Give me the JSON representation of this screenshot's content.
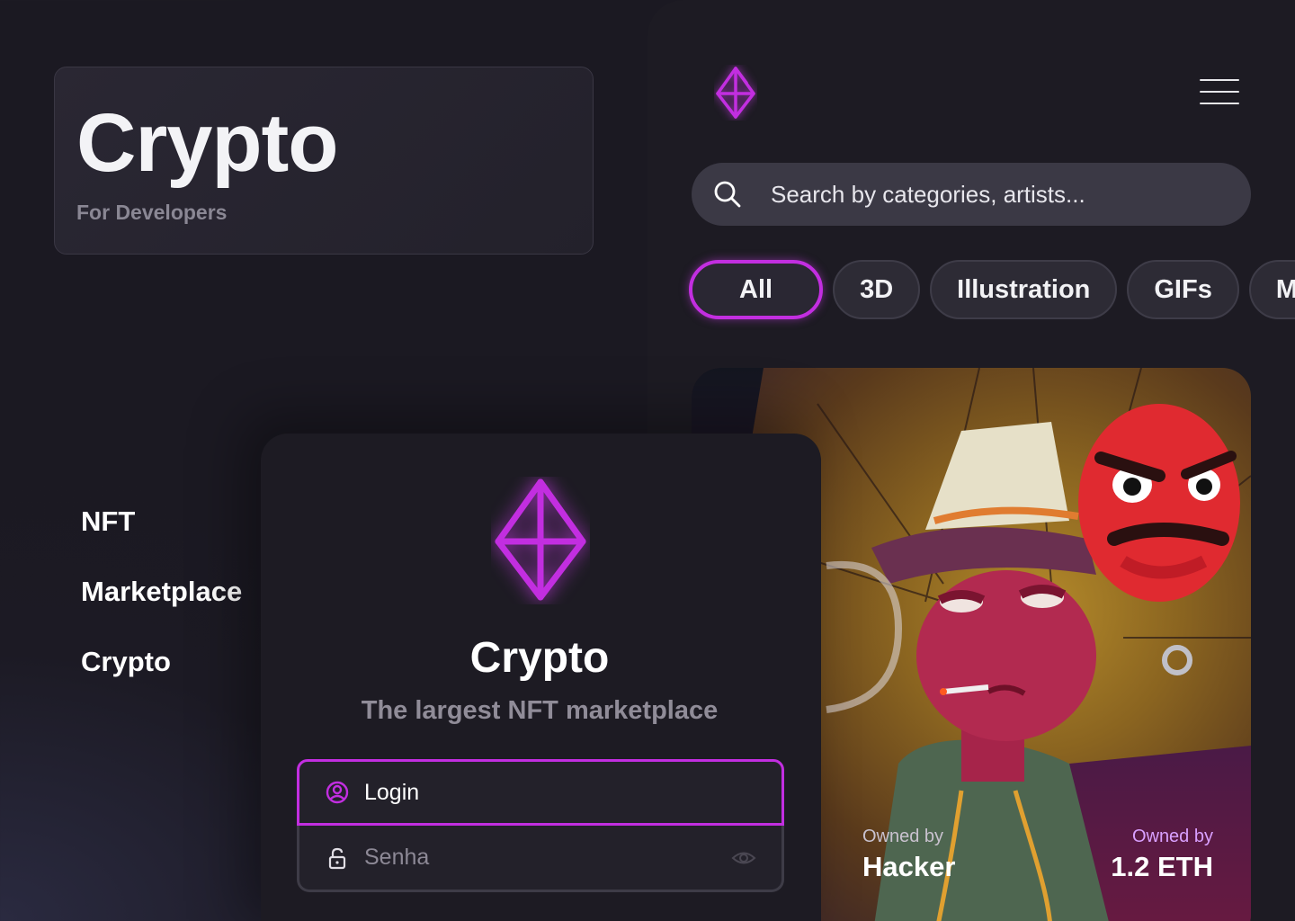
{
  "header": {
    "title": "Crypto",
    "subtitle": "For Developers"
  },
  "app": {
    "logo_icon": "ethereum-diamond-icon",
    "menu_icon": "hamburger-menu-icon",
    "search": {
      "placeholder": "Search by categories, artists...",
      "icon": "search-icon"
    },
    "categories": [
      {
        "label": "All",
        "active": true
      },
      {
        "label": "3D",
        "active": false
      },
      {
        "label": "Illustration",
        "active": false
      },
      {
        "label": "GIFs",
        "active": false
      },
      {
        "label": "Mo",
        "active": false
      }
    ],
    "nft_card": {
      "owner_left_label": "Owned by",
      "owner_left_value": "Hacker",
      "owner_right_label": "Owned by",
      "owner_right_value": "1.2 ETH"
    }
  },
  "side_nav": {
    "items": [
      "NFT",
      "Marketplace",
      "Crypto"
    ]
  },
  "login": {
    "title": "Crypto",
    "tagline": "The largest NFT marketplace",
    "login_placeholder": "Login",
    "password_placeholder": "Senha"
  },
  "colors": {
    "accent": "#c22ee0",
    "background": "#1c1a24",
    "panel": "#1d1b23"
  }
}
